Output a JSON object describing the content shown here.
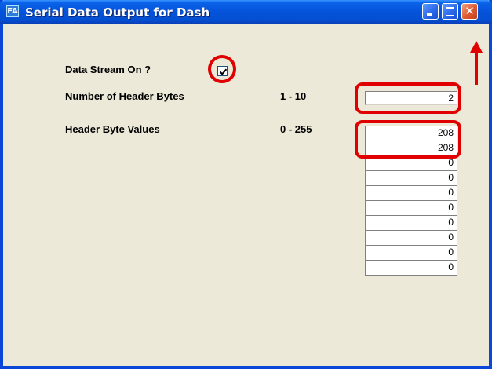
{
  "window": {
    "title": "Serial Data Output for Dash",
    "app_icon_text": "FA",
    "close_glyph": "✕"
  },
  "form": {
    "data_stream": {
      "label": "Data Stream On ?",
      "checked": true
    },
    "header_bytes": {
      "label": "Number of Header Bytes",
      "range": "1 - 10",
      "value": "2"
    },
    "header_values": {
      "label": "Header Byte Values",
      "range": "0 - 255",
      "values": [
        "208",
        "208",
        "0",
        "0",
        "0",
        "0",
        "0",
        "0",
        "0",
        "0"
      ]
    }
  },
  "annotations": {
    "color": "#e00000"
  }
}
